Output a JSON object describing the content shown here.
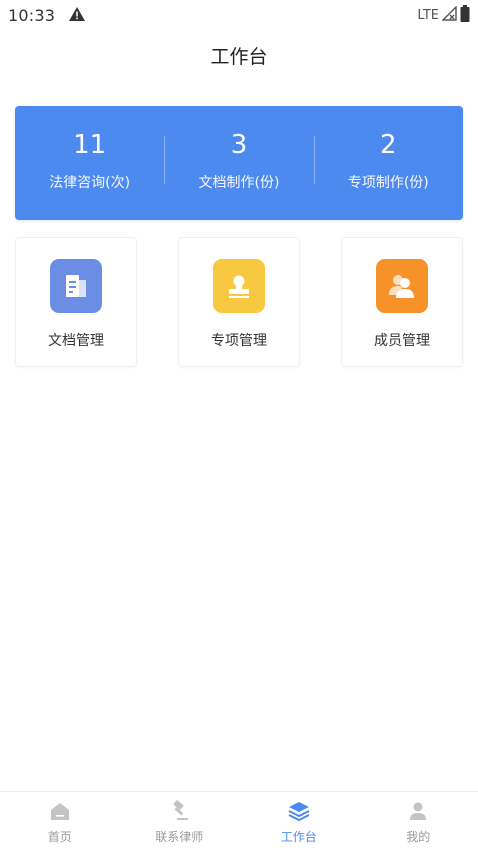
{
  "status_bar": {
    "time": "10:33",
    "network": "LTE",
    "icons": [
      "alert-icon",
      "signal-icon",
      "battery-icon"
    ]
  },
  "header": {
    "title": "工作台"
  },
  "stats": [
    {
      "value": "11",
      "label": "法律咨询(次)"
    },
    {
      "value": "3",
      "label": "文档制作(份)"
    },
    {
      "value": "2",
      "label": "专项制作(份)"
    }
  ],
  "tiles": [
    {
      "label": "文档管理",
      "icon": "document-building-icon",
      "color": "#6b8de3"
    },
    {
      "label": "专项管理",
      "icon": "stamp-icon",
      "color": "#f7c840"
    },
    {
      "label": "成员管理",
      "icon": "members-icon",
      "color": "#f7922a"
    }
  ],
  "bottom_nav": [
    {
      "label": "首页",
      "icon": "home-icon",
      "active": false
    },
    {
      "label": "联系律师",
      "icon": "gavel-icon",
      "active": false
    },
    {
      "label": "工作台",
      "icon": "layers-icon",
      "active": true
    },
    {
      "label": "我的",
      "icon": "user-icon",
      "active": false
    }
  ],
  "colors": {
    "accent": "#4d8af0",
    "nav_inactive": "#c4c4c4"
  }
}
